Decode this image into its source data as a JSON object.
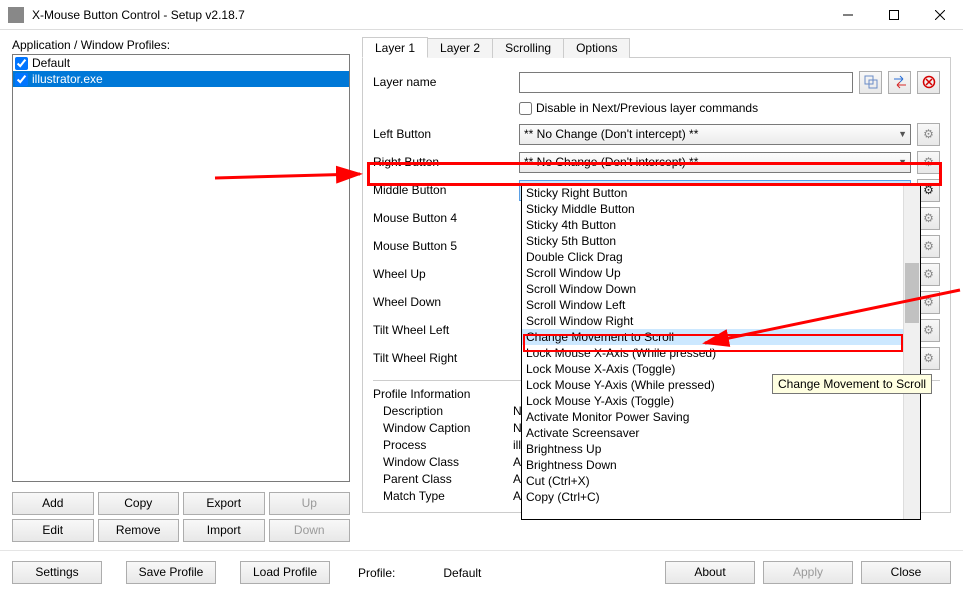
{
  "window": {
    "title": "X-Mouse Button Control - Setup v2.18.7"
  },
  "left": {
    "heading": "Application / Window Profiles:",
    "profiles": [
      {
        "label": "Default",
        "checked": true,
        "selected": false
      },
      {
        "label": "illustrator.exe",
        "checked": true,
        "selected": true
      }
    ],
    "buttons": {
      "add": "Add",
      "copy": "Copy",
      "export": "Export",
      "up": "Up",
      "edit": "Edit",
      "remove": "Remove",
      "import": "Import",
      "down": "Down"
    }
  },
  "tabs": {
    "layer1": "Layer 1",
    "layer2": "Layer 2",
    "scrolling": "Scrolling",
    "options": "Options"
  },
  "form": {
    "layerName": {
      "label": "Layer name",
      "value": ""
    },
    "disableChk": "Disable in Next/Previous layer commands",
    "noChange": "** No Change (Don't intercept) **",
    "rows": {
      "left": {
        "label": "Left Button"
      },
      "right": {
        "label": "Right Button"
      },
      "middle": {
        "label": "Middle Button",
        "value": "Change Movement to Scroll"
      },
      "mb4": {
        "label": "Mouse Button 4"
      },
      "mb5": {
        "label": "Mouse Button 5"
      },
      "wu": {
        "label": "Wheel Up"
      },
      "wd": {
        "label": "Wheel Down"
      },
      "twl": {
        "label": "Tilt Wheel Left"
      },
      "twr": {
        "label": "Tilt Wheel Right"
      }
    }
  },
  "dropdown": {
    "items": [
      "Sticky Right Button",
      "Sticky Middle Button",
      "Sticky 4th Button",
      "Sticky 5th Button",
      "Double Click Drag",
      "Scroll Window Up",
      "Scroll Window Down",
      "Scroll Window Left",
      "Scroll Window Right",
      "Change Movement to Scroll",
      "Lock Mouse X-Axis (While pressed)",
      "Lock Mouse X-Axis (Toggle)",
      "Lock Mouse Y-Axis (While pressed)",
      "Lock Mouse Y-Axis (Toggle)",
      "Activate Monitor Power Saving",
      "Activate Screensaver",
      "Brightness Up",
      "Brightness Down",
      "Cut (Ctrl+X)",
      "Copy (Ctrl+C)"
    ],
    "hoverIndex": 9,
    "tooltip": "Change Movement to Scroll"
  },
  "profileInfo": {
    "heading": "Profile Information",
    "rows": {
      "description": {
        "label": "Description",
        "value": "Not Defined"
      },
      "windowCaption": {
        "label": "Window Caption",
        "value": "Not Defined"
      },
      "process": {
        "label": "Process",
        "value": "illustrator.exe"
      },
      "windowClass": {
        "label": "Window Class",
        "value": "All Windows"
      },
      "parentClass": {
        "label": "Parent Class",
        "value": "All Windows"
      },
      "matchType": {
        "label": "Match Type",
        "value": "Application"
      }
    }
  },
  "footer": {
    "settings": "Settings",
    "saveProfile": "Save Profile",
    "loadProfile": "Load Profile",
    "profileLbl": "Profile:",
    "profileName": "Default",
    "about": "About",
    "apply": "Apply",
    "close": "Close"
  }
}
